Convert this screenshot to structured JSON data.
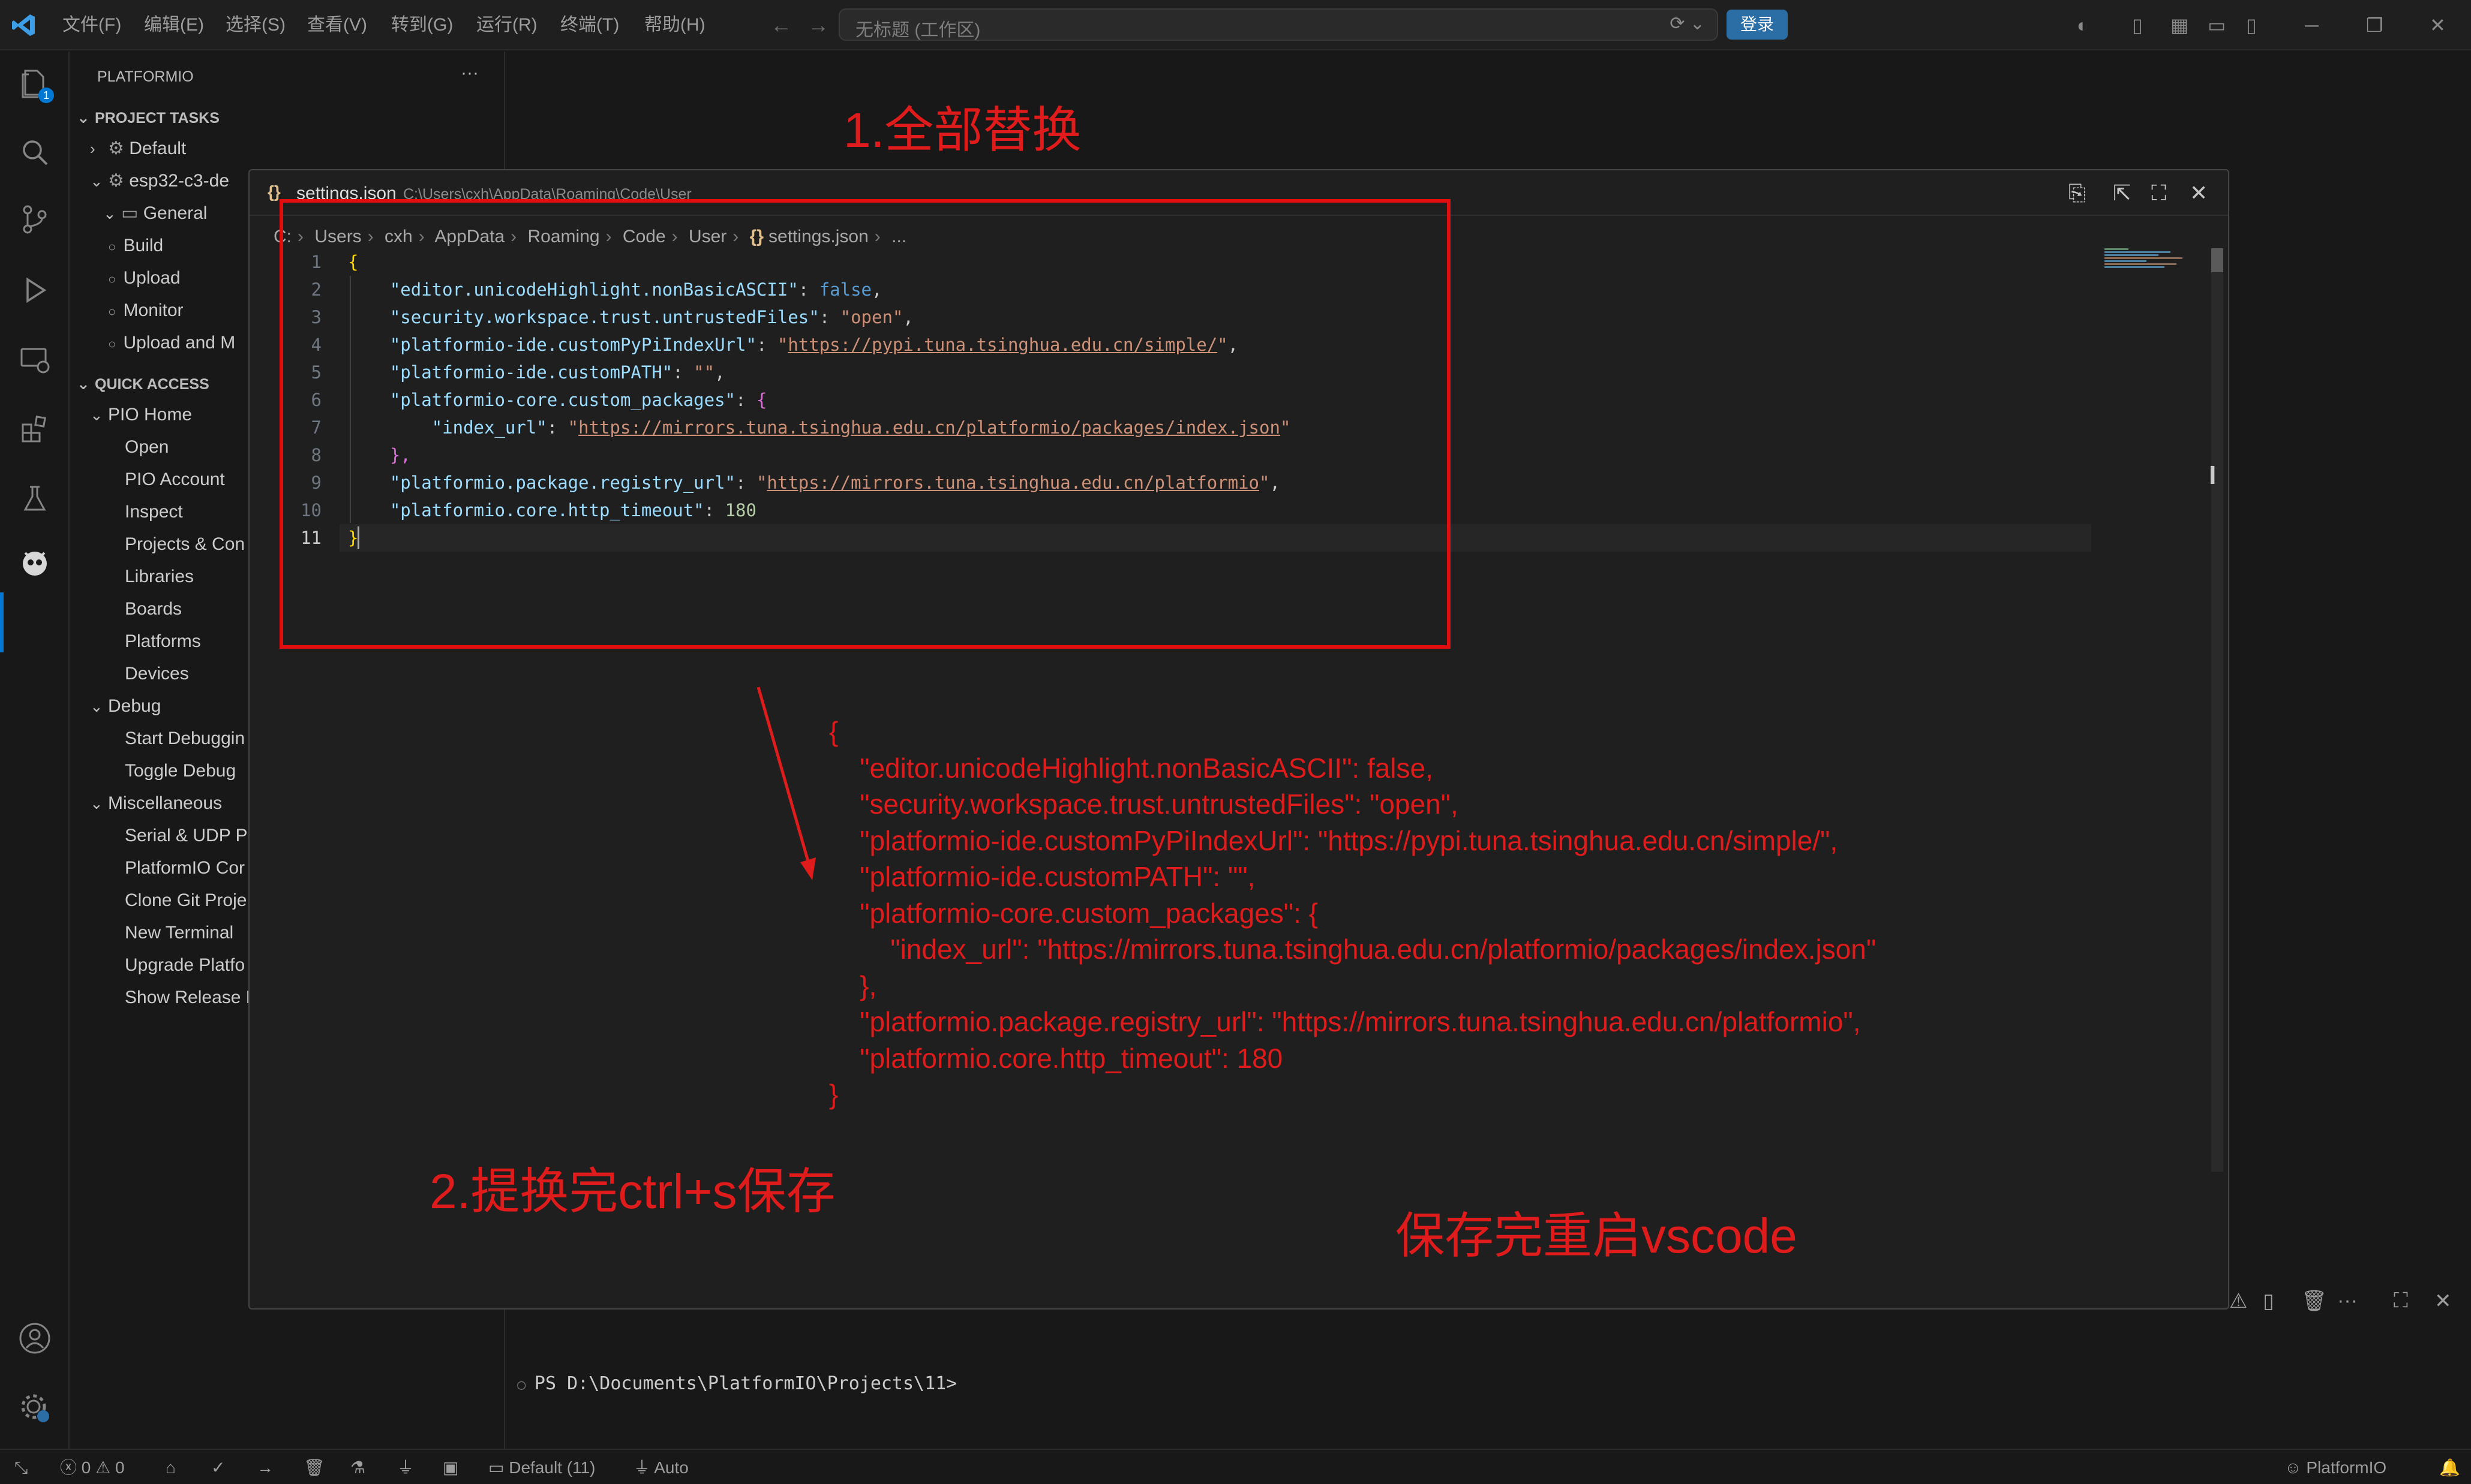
{
  "menu": [
    "文件(F)",
    "编辑(E)",
    "选择(S)",
    "查看(V)",
    "转到(G)",
    "运行(R)",
    "终端(T)",
    "帮助(H)"
  ],
  "command_center": {
    "title": "无标题 (工作区)"
  },
  "login_label": "登录",
  "activity_badge": "1",
  "sidebar": {
    "title": "PLATFORMIO",
    "more": "···",
    "project_tasks": {
      "header": "PROJECT TASKS",
      "default": "Default",
      "env": "esp32-c3-de",
      "general": "General",
      "tasks": [
        "Build",
        "Upload",
        "Monitor",
        "Upload and M"
      ]
    },
    "quick_access": {
      "header": "QUICK ACCESS",
      "pio_home": "PIO Home",
      "pio_home_items": [
        "Open",
        "PIO Account",
        "Inspect",
        "Projects & Con",
        "Libraries",
        "Boards",
        "Platforms",
        "Devices"
      ],
      "debug": "Debug",
      "debug_items": [
        "Start Debuggin",
        "Toggle Debug"
      ],
      "misc": "Miscellaneous",
      "misc_items": [
        "Serial & UDP P",
        "PlatformIO Cor",
        "Clone Git Proje",
        "New Terminal",
        "Upgrade Platfo",
        "Show Release N"
      ]
    }
  },
  "popup": {
    "filename": "settings.json",
    "path": "C:\\Users\\cxh\\AppData\\Roaming\\Code\\User",
    "breadcrumb": [
      "C:",
      "Users",
      "cxh",
      "AppData",
      "Roaming",
      "Code",
      "User"
    ],
    "breadcrumb_file": "settings.json",
    "breadcrumb_tail": "...",
    "line_numbers": [
      "1",
      "2",
      "3",
      "4",
      "5",
      "6",
      "7",
      "8",
      "9",
      "10",
      "11"
    ],
    "code": {
      "l1_open": "{",
      "l2_key": "\"editor.unicodeHighlight.nonBasicASCII\"",
      "l2_val": "false",
      "l3_key": "\"security.workspace.trust.untrustedFiles\"",
      "l3_val": "\"open\"",
      "l4_key": "\"platformio-ide.customPyPiIndexUrl\"",
      "l4_url": "https://pypi.tuna.tsinghua.edu.cn/simple/",
      "l5_key": "\"platformio-ide.customPATH\"",
      "l5_val": "\"\"",
      "l6_key": "\"platformio-core.custom_packages\"",
      "l6_open": "{",
      "l7_key": "\"index_url\"",
      "l7_url": "https://mirrors.tuna.tsinghua.edu.cn/platformio/packages/index.json",
      "l8_close": "},",
      "l9_key": "\"platformio.package.registry_url\"",
      "l9_url": "https://mirrors.tuna.tsinghua.edu.cn/platformio",
      "l10_key": "\"platformio.core.http_timeout\"",
      "l10_val": "180",
      "l11_close": "}"
    }
  },
  "annotations": {
    "step1": "1.全部替换",
    "step2": "2.提换完ctrl+s保存",
    "step3": "保存完重启vscode",
    "code_block": "{\n    \"editor.unicodeHighlight.nonBasicASCII\": false,\n    \"security.workspace.trust.untrustedFiles\": \"open\",\n    \"platformio-ide.customPyPiIndexUrl\": \"https://pypi.tuna.tsinghua.edu.cn/simple/\",\n    \"platformio-ide.customPATH\": \"\",\n    \"platformio-core.custom_packages\": {\n        \"index_url\": \"https://mirrors.tuna.tsinghua.edu.cn/platformio/packages/index.json\"\n    },\n    \"platformio.package.registry_url\": \"https://mirrors.tuna.tsinghua.edu.cn/platformio\",\n    \"platformio.core.http_timeout\": 180\n}"
  },
  "terminal": {
    "prompt": "PS D:\\Documents\\PlatformIO\\Projects\\11>"
  },
  "statusbar": {
    "errors": "0",
    "warnings": "0",
    "env": "Default (11)",
    "port": "Auto",
    "platformio": "PlatformIO"
  },
  "colors": {
    "accent": "#0078d4",
    "annotation": "#e01b1b",
    "login_button": "#2b6ea6"
  }
}
